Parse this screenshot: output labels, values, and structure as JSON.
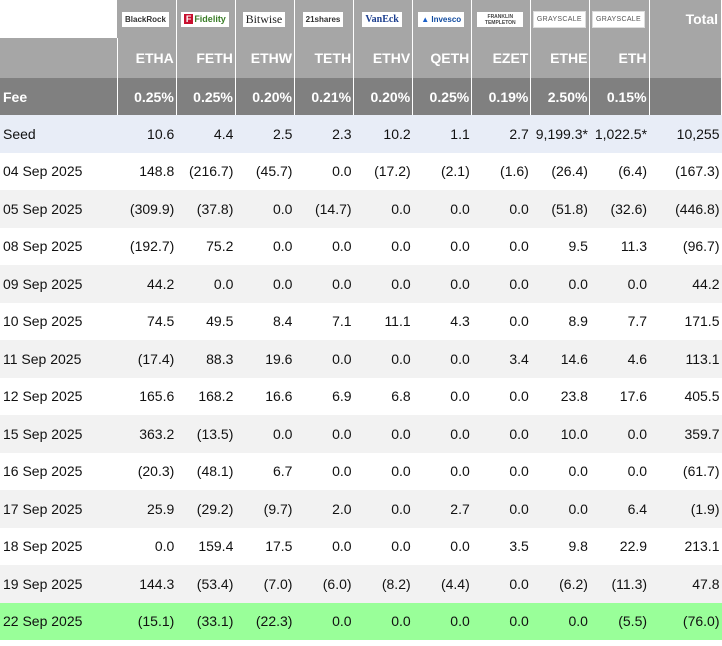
{
  "issuers": [
    "BlackRock",
    "Fidelity",
    "Bitwise",
    "21shares",
    "VanEck",
    "Invesco",
    "FRANKLIN TEMPLETON",
    "GRAYSCALE",
    "GRAYSCALE"
  ],
  "total_label": "Total",
  "tickers": [
    "ETHA",
    "FETH",
    "ETHW",
    "TETH",
    "ETHV",
    "QETH",
    "EZET",
    "ETHE",
    "ETH"
  ],
  "fee_label": "Fee",
  "fees": [
    "0.25%",
    "0.25%",
    "0.20%",
    "0.21%",
    "0.20%",
    "0.25%",
    "0.19%",
    "2.50%",
    "0.15%"
  ],
  "rows": [
    {
      "label": "Seed",
      "cells": [
        "10.6",
        "4.4",
        "2.5",
        "2.3",
        "10.2",
        "1.1",
        "2.7",
        "9,199.3*",
        "1,022.5*",
        "10,255"
      ]
    },
    {
      "label": "04 Sep 2025",
      "cells": [
        "148.8",
        "(216.7)",
        "(45.7)",
        "0.0",
        "(17.2)",
        "(2.1)",
        "(1.6)",
        "(26.4)",
        "(6.4)",
        "(167.3)"
      ]
    },
    {
      "label": "05 Sep 2025",
      "cells": [
        "(309.9)",
        "(37.8)",
        "0.0",
        "(14.7)",
        "0.0",
        "0.0",
        "0.0",
        "(51.8)",
        "(32.6)",
        "(446.8)"
      ]
    },
    {
      "label": "08 Sep 2025",
      "cells": [
        "(192.7)",
        "75.2",
        "0.0",
        "0.0",
        "0.0",
        "0.0",
        "0.0",
        "9.5",
        "11.3",
        "(96.7)"
      ]
    },
    {
      "label": "09 Sep 2025",
      "cells": [
        "44.2",
        "0.0",
        "0.0",
        "0.0",
        "0.0",
        "0.0",
        "0.0",
        "0.0",
        "0.0",
        "44.2"
      ]
    },
    {
      "label": "10 Sep 2025",
      "cells": [
        "74.5",
        "49.5",
        "8.4",
        "7.1",
        "11.1",
        "4.3",
        "0.0",
        "8.9",
        "7.7",
        "171.5"
      ]
    },
    {
      "label": "11 Sep 2025",
      "cells": [
        "(17.4)",
        "88.3",
        "19.6",
        "0.0",
        "0.0",
        "0.0",
        "3.4",
        "14.6",
        "4.6",
        "113.1"
      ]
    },
    {
      "label": "12 Sep 2025",
      "cells": [
        "165.6",
        "168.2",
        "16.6",
        "6.9",
        "6.8",
        "0.0",
        "0.0",
        "23.8",
        "17.6",
        "405.5"
      ]
    },
    {
      "label": "15 Sep 2025",
      "cells": [
        "363.2",
        "(13.5)",
        "0.0",
        "0.0",
        "0.0",
        "0.0",
        "0.0",
        "10.0",
        "0.0",
        "359.7"
      ]
    },
    {
      "label": "16 Sep 2025",
      "cells": [
        "(20.3)",
        "(48.1)",
        "6.7",
        "0.0",
        "0.0",
        "0.0",
        "0.0",
        "0.0",
        "0.0",
        "(61.7)"
      ]
    },
    {
      "label": "17 Sep 2025",
      "cells": [
        "25.9",
        "(29.2)",
        "(9.7)",
        "2.0",
        "0.0",
        "2.7",
        "0.0",
        "0.0",
        "6.4",
        "(1.9)"
      ]
    },
    {
      "label": "18 Sep 2025",
      "cells": [
        "0.0",
        "159.4",
        "17.5",
        "0.0",
        "0.0",
        "0.0",
        "3.5",
        "9.8",
        "22.9",
        "213.1"
      ]
    },
    {
      "label": "19 Sep 2025",
      "cells": [
        "144.3",
        "(53.4)",
        "(7.0)",
        "(6.0)",
        "(8.2)",
        "(4.4)",
        "0.0",
        "(6.2)",
        "(11.3)",
        "47.8"
      ]
    },
    {
      "label": "22 Sep 2025",
      "cells": [
        "(15.1)",
        "(33.1)",
        "(22.3)",
        "0.0",
        "0.0",
        "0.0",
        "0.0",
        "0.0",
        "(5.5)",
        "(76.0)"
      ]
    }
  ],
  "colors": {
    "negative": "#e60000",
    "header_bg": "#a6a6a6",
    "fee_bg": "#808080",
    "latest_row_bg": "#99ff99"
  }
}
